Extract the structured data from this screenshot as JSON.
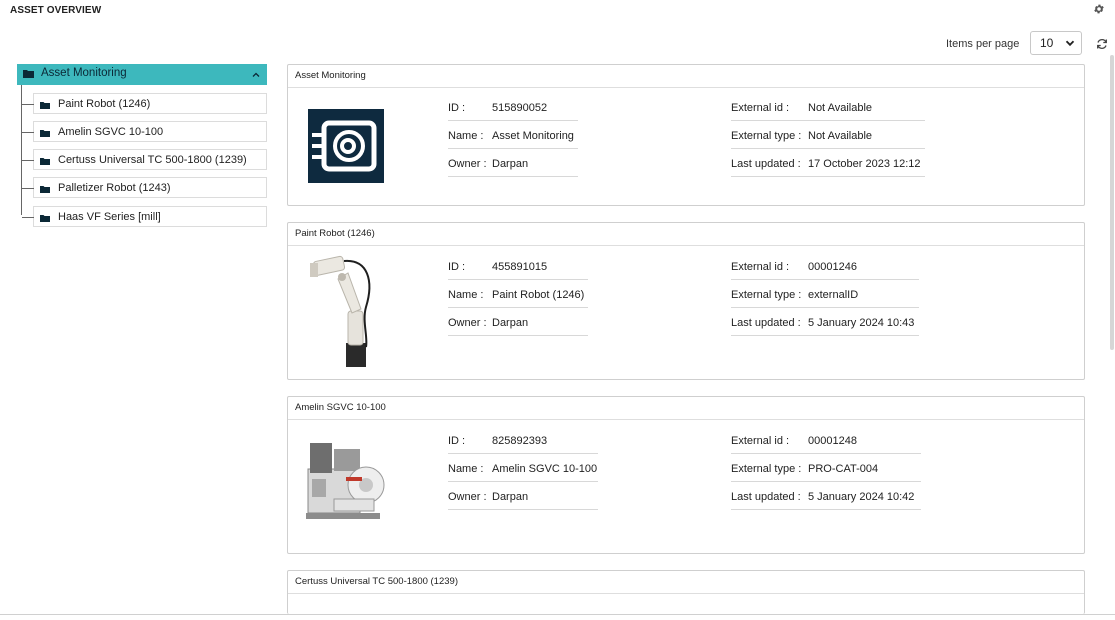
{
  "header": {
    "title": "ASSET OVERVIEW"
  },
  "pagination": {
    "items_per_page_label": "Items per page",
    "items_per_page_value": "10"
  },
  "tree": {
    "root": {
      "label": "Asset Monitoring"
    },
    "items": [
      {
        "label": "Paint Robot (1246)"
      },
      {
        "label": "Amelin SGVC 10-100"
      },
      {
        "label": "Certuss Universal TC 500-1800 (1239)"
      },
      {
        "label": "Palletizer Robot (1243)"
      },
      {
        "label": "Haas VF Series [mill]"
      }
    ]
  },
  "labels": {
    "id": "ID :",
    "name": "Name :",
    "owner": "Owner :",
    "external_id": "External id :",
    "external_type": "External type :",
    "last_updated": "Last updated :"
  },
  "cards": [
    {
      "title": "Asset Monitoring",
      "id": "515890052",
      "name": "Asset Monitoring",
      "owner": "Darpan",
      "external_id": "Not Available",
      "external_type": "Not Available",
      "last_updated": "17 October 2023 12:12",
      "image": "asset-monitoring-logo"
    },
    {
      "title": "Paint Robot (1246)",
      "id": "455891015",
      "name": "Paint Robot (1246)",
      "owner": "Darpan",
      "external_id": "00001246",
      "external_type": "externalID",
      "last_updated": "5 January 2024 10:43",
      "image": "paint-robot-photo"
    },
    {
      "title": "Amelin SGVC 10-100",
      "id": "825892393",
      "name": "Amelin SGVC 10-100",
      "owner": "Darpan",
      "external_id": "00001248",
      "external_type": "PRO-CAT-004",
      "last_updated": "5 January 2024 10:42",
      "image": "amelin-machine-photo"
    },
    {
      "title": "Certuss Universal TC 500-1800 (1239)"
    }
  ],
  "colors": {
    "accent": "#3db8bd",
    "logo_bg": "#0e2a3f"
  },
  "icons": {
    "settings": "gear-icon",
    "refresh": "refresh-icon",
    "folder": "folder-icon",
    "collapse": "chevron-up-icon",
    "dropdown": "chevron-down-icon"
  }
}
